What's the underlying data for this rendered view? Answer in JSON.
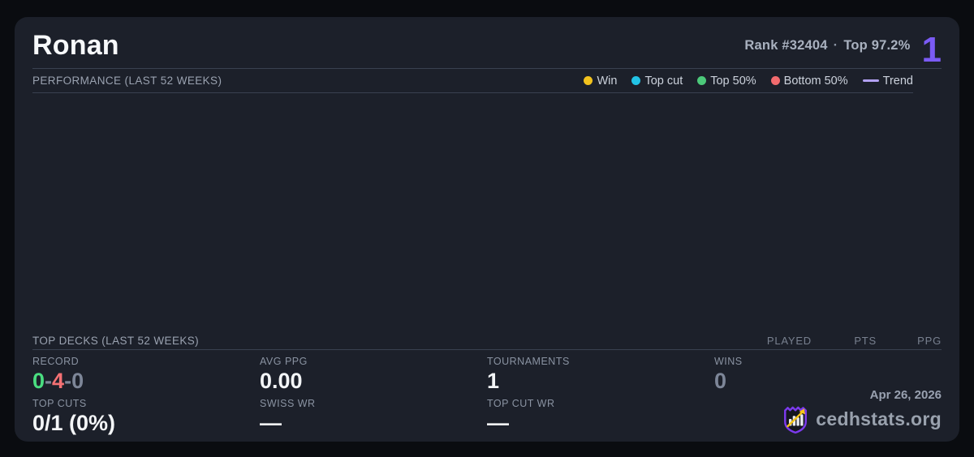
{
  "header": {
    "title": "Ronan",
    "rank_text": "Rank #32404",
    "rank_separator": "·",
    "top_percent_text": "Top 97.2%",
    "highlight_number": "1"
  },
  "performance": {
    "section_title": "PERFORMANCE (LAST 52 WEEKS)",
    "plot_empty": true,
    "legend": [
      {
        "label": "Win",
        "swatch": "dot",
        "color": "#f2c21d"
      },
      {
        "label": "Top cut",
        "swatch": "dot",
        "color": "#22c3e6"
      },
      {
        "label": "Top 50%",
        "swatch": "dot",
        "color": "#4cc97a"
      },
      {
        "label": "Bottom 50%",
        "swatch": "dot",
        "color": "#f26b6e"
      },
      {
        "label": "Trend",
        "swatch": "line",
        "color": "#b2a1f2"
      }
    ]
  },
  "top_decks": {
    "section_title": "TOP DECKS (LAST 52 WEEKS)",
    "columns": [
      "PLAYED",
      "PTS",
      "PPG"
    ],
    "rows": []
  },
  "stats": {
    "record": {
      "label": "RECORD",
      "wins": "0",
      "losses": "4",
      "draws": "0",
      "separator": "-"
    },
    "avg_ppg": {
      "label": "AVG PPG",
      "value": "0.00"
    },
    "tournaments": {
      "label": "TOURNAMENTS",
      "value": "1"
    },
    "wins": {
      "label": "WINS",
      "value": "0"
    },
    "top_cuts": {
      "label": "TOP CUTS",
      "value": "0/1 (0%)"
    },
    "swiss_wr": {
      "label": "SWISS WR",
      "value": "—"
    },
    "top_cut_wr": {
      "label": "TOP CUT WR",
      "value": "—"
    }
  },
  "footer": {
    "date": "Apr 26, 2026",
    "brand": "cedhstats.org"
  },
  "colors": {
    "page_bg": "#0a0c10",
    "card_bg": "#1c202a",
    "accent_purple": "#7b5bf5",
    "win_yellow": "#f2c21d",
    "top_cut_cyan": "#22c3e6",
    "top50_green": "#4cc97a",
    "bottom50_red": "#f26b6e",
    "trend_purple": "#b2a1f2",
    "record_win_green": "#4ade80",
    "record_loss_red": "#f47174",
    "muted_gray": "#7d8698",
    "logo_shield_purple": "#7c3aed",
    "logo_arrow_yellow": "#f5c518"
  }
}
